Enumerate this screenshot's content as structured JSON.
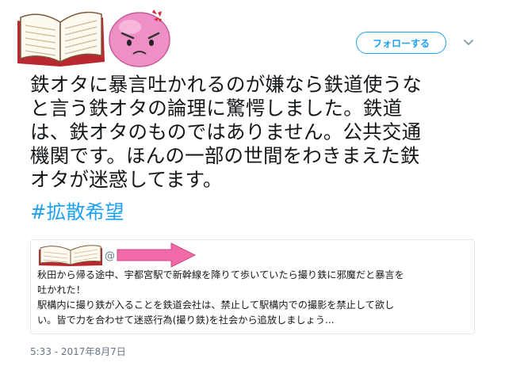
{
  "header": {
    "follow_label": "フォローする",
    "avatar_icon": "book-and-angry-face-avatar",
    "caret_icon": "chevron-down-icon"
  },
  "tweet": {
    "text": "鉄オタに暴言吐かれるのが嫌なら鉄道使うな\nと言う鉄オタの論理に驚愕しました。鉄道\nは、鉄オタのものではありません。公共交通\n機関です。ほんの一部の世間をわきまえた鉄\nオタが迷惑してます。",
    "hashtag": "#拡散希望",
    "timestamp": "5:33 - 2017年8月7日"
  },
  "quote": {
    "handle_prefix": "@",
    "text": "秋田から帰る途中、宇都宮駅で新幹線を降りて歩いていたら撮り鉄に邪魔だと暴言を\n吐かれた！\n駅構内に撮り鉄が入ることを鉄道会社は、禁止して駅構内での撮影を禁止して欲し\nい。皆で力を合わせて迷惑行為(撮り鉄)を社会から追放しましょう..."
  },
  "colors": {
    "accent": "#1da1f2",
    "text": "#14171a",
    "muted": "#657786",
    "border": "#e1e8ed",
    "arrow": "#f06aa8",
    "book_cover": "#b8282e"
  }
}
